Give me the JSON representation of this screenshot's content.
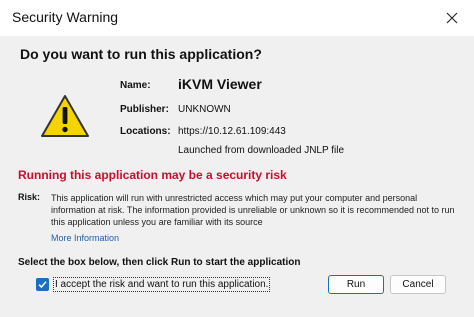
{
  "window": {
    "title": "Security Warning"
  },
  "dialog": {
    "headline": "Do you want to run this application?",
    "info": {
      "name_label": "Name:",
      "name_value": "iKVM Viewer",
      "publisher_label": "Publisher:",
      "publisher_value": "UNKNOWN",
      "locations_label": "Locations:",
      "location_url": "https://10.12.61.109:443",
      "location_note": "Launched from downloaded JNLP file"
    },
    "risk_heading": "Running this application may be a security risk",
    "risk_label": "Risk:",
    "risk_text": "This application will run with unrestricted access which may put your computer and personal information at risk. The information provided is unreliable or unknown so it is recommended not to run this application unless you are familiar with its source",
    "more_info": "More Information",
    "select_instruction": "Select the box below, then click Run to start the application",
    "accept_label": "I accept the risk and want to run this application.",
    "accept_checked": true,
    "run_label": "Run",
    "cancel_label": "Cancel"
  },
  "colors": {
    "risk_heading": "#c8102e",
    "checkbox": "#1a6fc4",
    "link": "#1f5fa8",
    "warning_fill": "#f5d400"
  },
  "icons": {
    "warning": "warning-triangle-icon",
    "close": "close-icon",
    "check": "checkmark-icon"
  }
}
